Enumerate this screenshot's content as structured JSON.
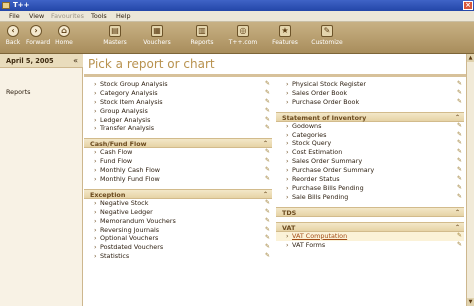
{
  "app": {
    "title": "T++"
  },
  "menu": [
    {
      "label": "File",
      "disabled": false
    },
    {
      "label": "View",
      "disabled": false
    },
    {
      "label": "Favourites",
      "disabled": true
    },
    {
      "label": "Tools",
      "disabled": false
    },
    {
      "label": "Help",
      "disabled": false
    }
  ],
  "toolbar": [
    {
      "label": "Back",
      "icon": "back-arrow-icon"
    },
    {
      "label": "Forward",
      "icon": "forward-arrow-icon"
    },
    {
      "label": "Home",
      "icon": "home-icon"
    },
    {
      "label": "Masters",
      "icon": "masters-icon"
    },
    {
      "label": "Vouchers",
      "icon": "vouchers-icon"
    },
    {
      "label": "Reports",
      "icon": "reports-icon"
    },
    {
      "label": "T++.com",
      "icon": "globe-icon"
    },
    {
      "label": "Features",
      "icon": "features-icon"
    },
    {
      "label": "Customize",
      "icon": "customize-icon"
    }
  ],
  "sidebar": {
    "date": "April 5, 2005",
    "reports_label": "Reports"
  },
  "main": {
    "heading": "Pick a report or chart"
  },
  "left_column": {
    "top_items": [
      "Stock Group Analysis",
      "Category Analysis",
      "Stock Item Analysis",
      "Group Analysis",
      "Ledger Analysis",
      "Transfer Analysis"
    ],
    "sections": [
      {
        "title": "Cash/Fund Flow",
        "items": [
          "Cash Flow",
          "Fund Flow",
          "Monthly Cash Flow",
          "Monthly Fund Flow"
        ]
      },
      {
        "title": "Exception",
        "items": [
          "Negative Stock",
          "Negative Ledger",
          "Memorandum Vouchers",
          "Reversing Journals",
          "Optional Vouchers",
          "Postdated Vouchers",
          "Statistics"
        ]
      }
    ]
  },
  "right_column": {
    "top_items": [
      "Physical Stock Register",
      "Sales Order Book",
      "Purchase Order Book"
    ],
    "sections": [
      {
        "title": "Statement of Inventory",
        "items": [
          "Godowns",
          "Categories",
          "Stock Query",
          "Cost Estimation",
          "Sales Order Summary",
          "Purchase Order Summary",
          "Reorder Status",
          "Purchase Bills Pending",
          "Sale Bills Pending"
        ]
      },
      {
        "title": "TDS",
        "items": []
      },
      {
        "title": "VAT",
        "items": [
          "VAT Computation",
          "VAT Forms"
        ],
        "selected": 0
      }
    ]
  },
  "colors": {
    "accent": "#b8924e",
    "toolbar": "#b79e6f",
    "titlebar": "#2f52b8"
  }
}
